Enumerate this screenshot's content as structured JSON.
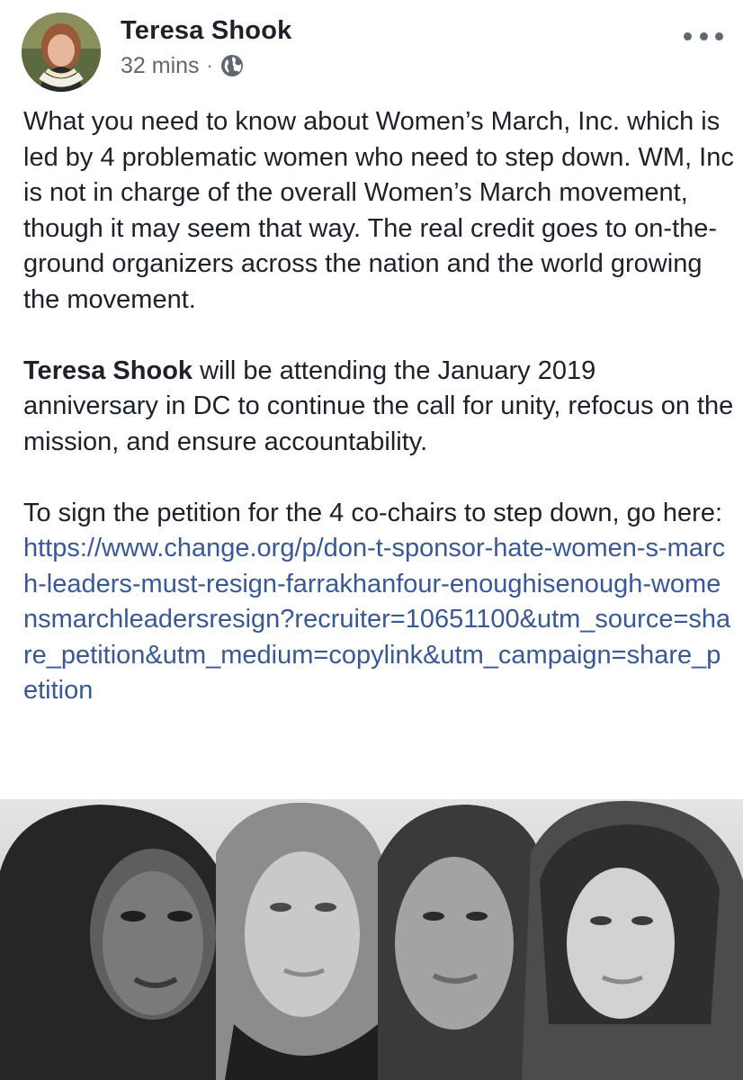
{
  "post": {
    "author": {
      "name": "Teresa Shook",
      "avatar_icon": "profile-photo-icon"
    },
    "timestamp": "32 mins",
    "separator": "·",
    "privacy_icon": "globe-icon",
    "more_icon": "more-options-icon",
    "paragraph1": "What you need to know about Women’s March, Inc. which is led by 4 problematic women who need to step down. WM, Inc is not in charge of the overall Women’s March movement, though it may seem that way. The real credit goes to on-the-ground organizers across the nation and the world growing the movement.",
    "paragraph2": {
      "mention": "Teresa Shook",
      "text": " will be attending the January 2019 anniversary in DC to continue the call for unity, refocus on the mission, and ensure accountability."
    },
    "paragraph3": "To sign the petition for the 4 co-chairs to step down, go here:",
    "link": "https://www.change.org/p/don-t-sponsor-hate-women-s-march-leaders-must-resign-farrakhanfour-enoughisenough-womensmarchleadersresign?recruiter=10651100&utm_source=share_petition&utm_medium=copylink&utm_campaign=share_petition"
  },
  "colors": {
    "text": "#1d2129",
    "secondary": "#606770",
    "link": "#385898"
  }
}
